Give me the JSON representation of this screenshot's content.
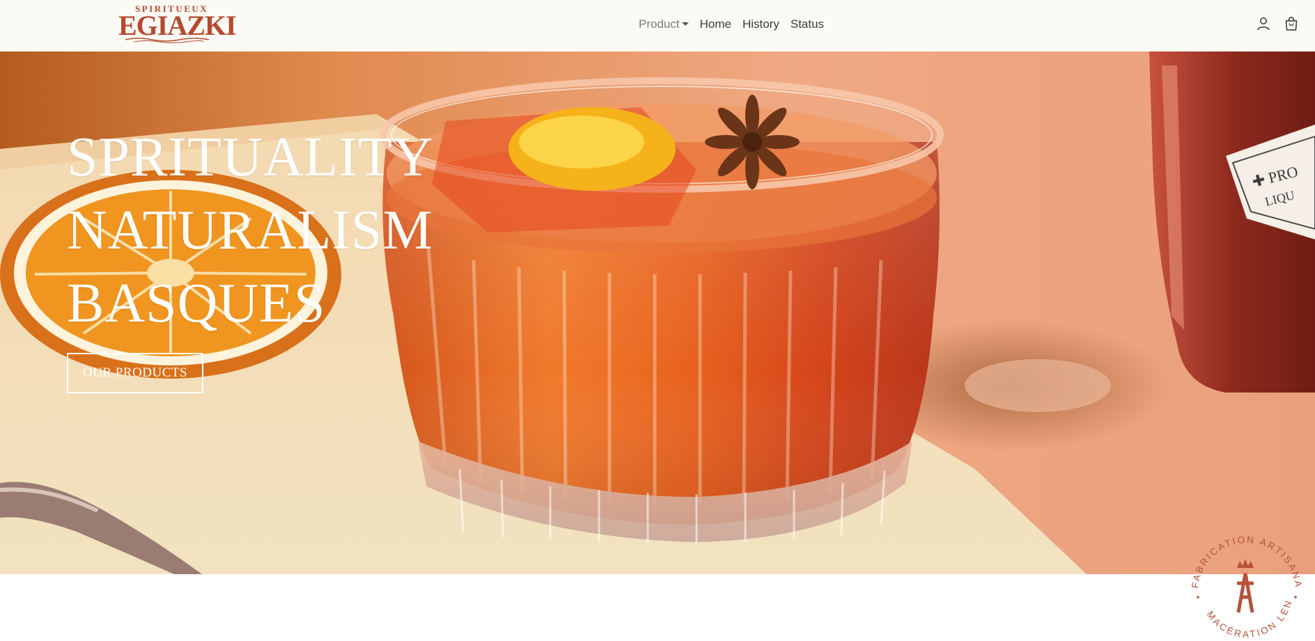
{
  "brand": {
    "name": "EGIAZKI",
    "tagline": "SPIRITUEUX",
    "color": "#b54a30"
  },
  "nav": {
    "items": [
      {
        "label": "Product",
        "has_dropdown": true,
        "muted": true
      },
      {
        "label": "Home"
      },
      {
        "label": "History"
      },
      {
        "label": "Status"
      }
    ],
    "icons": [
      "user-icon",
      "shopping-bag-icon"
    ]
  },
  "hero": {
    "lines": [
      "SPRITUALITY",
      "NATURALISM",
      "BASQUES"
    ],
    "button_label": "OUR PRODUCTS",
    "image_subject": "cocktail glass with orange slice and star anise"
  },
  "badge": {
    "top_text": "FABRICATION ARTISANALE",
    "bottom_text": "MACÉRATION LENTE",
    "color": "#b4533a"
  }
}
